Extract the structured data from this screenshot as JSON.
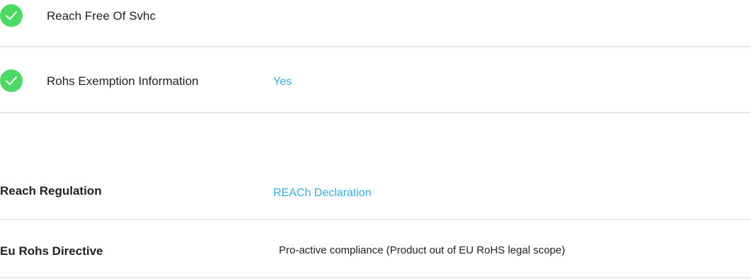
{
  "compliance_flags": [
    {
      "label": "Reach Free Of Svhc",
      "status_icon": "check-circle-icon",
      "value": ""
    },
    {
      "label": "Rohs Exemption Information",
      "status_icon": "check-circle-icon",
      "value": "Yes"
    }
  ],
  "regulations": [
    {
      "label": "Reach Regulation",
      "value": "REACh Declaration",
      "value_is_link": true
    },
    {
      "label": "Eu Rohs Directive",
      "value": "Pro-active compliance (Product out of EU RoHS legal scope)",
      "value_is_link": false
    }
  ],
  "colors": {
    "check_green": "#4cd964",
    "link_blue": "#3aa9e0",
    "divider": "#e8e8e8"
  }
}
